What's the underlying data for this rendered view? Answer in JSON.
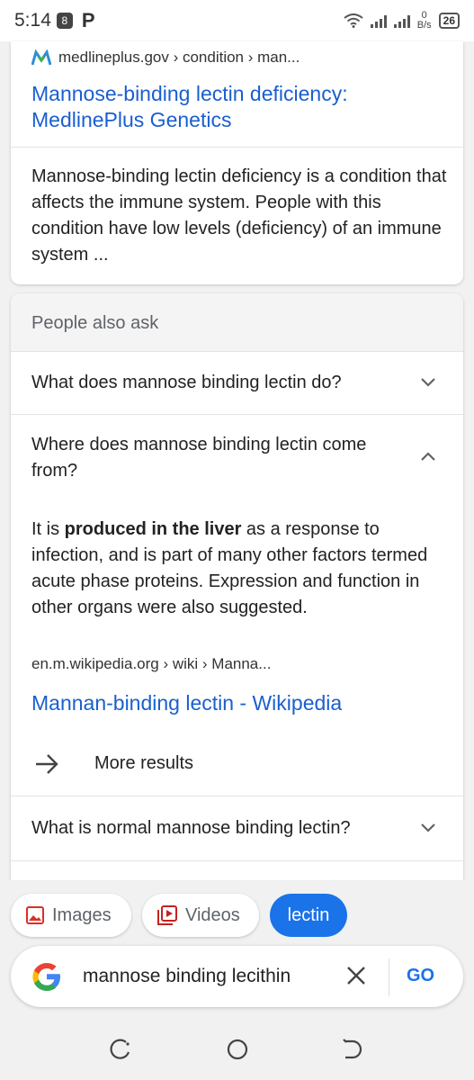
{
  "status_bar": {
    "time": "5:14",
    "notif_badge": "8",
    "notif_app": "P",
    "speed_value": "0",
    "speed_unit": "B/s",
    "battery": "26"
  },
  "result": {
    "source": "medlineplus.gov › condition › man...",
    "title": "Mannose-binding lectin deficiency: MedlinePlus Genetics",
    "snippet": "Mannose-binding lectin deficiency is a condition that affects the immune system. People with this condition have low levels (deficiency) of an immune system ..."
  },
  "people_also_ask": {
    "header": "People also ask",
    "questions": [
      {
        "text": "What does mannose binding lectin do?",
        "expanded": false
      },
      {
        "text": "Where does mannose binding lectin come from?",
        "expanded": true
      },
      {
        "text": "What is normal mannose binding lectin?",
        "expanded": false
      }
    ],
    "answer": {
      "prefix": "It is ",
      "bold": "produced in the liver",
      "suffix": " as a response to infection, and is part of many other factors termed acute phase proteins. Expression and function in other organs were also suggested.",
      "source": "en.m.wikipedia.org › wiki › Manna...",
      "link_title": "Mannan-binding lectin - Wikipedia"
    },
    "more_results": "More results"
  },
  "chips": {
    "images": "Images",
    "videos": "Videos",
    "lectin": "lectin"
  },
  "search": {
    "query": "mannose binding lecithin",
    "go_label": "GO"
  },
  "colors": {
    "link": "#1a5fd0",
    "accent": "#1a73e8",
    "images_icon": "#d93025",
    "videos_icon": "#c5221f"
  }
}
